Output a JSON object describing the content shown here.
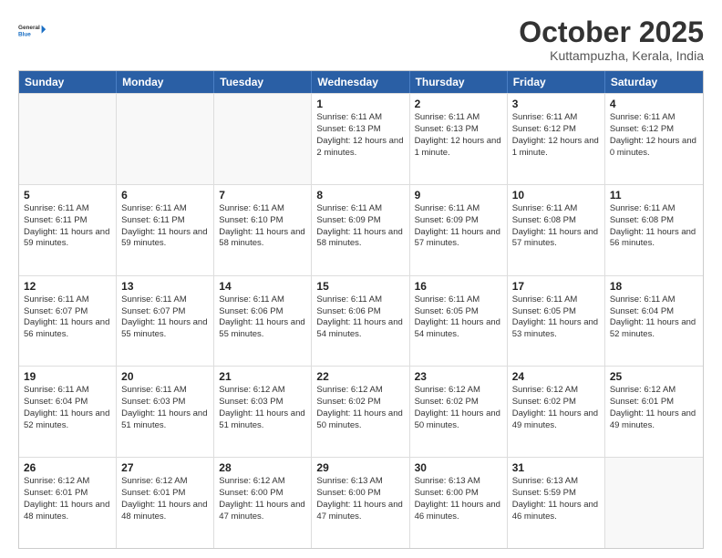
{
  "header": {
    "logo_general": "General",
    "logo_blue": "Blue",
    "month_title": "October 2025",
    "subtitle": "Kuttampuzha, Kerala, India"
  },
  "calendar": {
    "days_of_week": [
      "Sunday",
      "Monday",
      "Tuesday",
      "Wednesday",
      "Thursday",
      "Friday",
      "Saturday"
    ],
    "rows": [
      [
        {
          "day": "",
          "info": "",
          "empty": true
        },
        {
          "day": "",
          "info": "",
          "empty": true
        },
        {
          "day": "",
          "info": "",
          "empty": true
        },
        {
          "day": "1",
          "info": "Sunrise: 6:11 AM\nSunset: 6:13 PM\nDaylight: 12 hours\nand 2 minutes.",
          "empty": false
        },
        {
          "day": "2",
          "info": "Sunrise: 6:11 AM\nSunset: 6:13 PM\nDaylight: 12 hours\nand 1 minute.",
          "empty": false
        },
        {
          "day": "3",
          "info": "Sunrise: 6:11 AM\nSunset: 6:12 PM\nDaylight: 12 hours\nand 1 minute.",
          "empty": false
        },
        {
          "day": "4",
          "info": "Sunrise: 6:11 AM\nSunset: 6:12 PM\nDaylight: 12 hours\nand 0 minutes.",
          "empty": false
        }
      ],
      [
        {
          "day": "5",
          "info": "Sunrise: 6:11 AM\nSunset: 6:11 PM\nDaylight: 11 hours\nand 59 minutes.",
          "empty": false
        },
        {
          "day": "6",
          "info": "Sunrise: 6:11 AM\nSunset: 6:11 PM\nDaylight: 11 hours\nand 59 minutes.",
          "empty": false
        },
        {
          "day": "7",
          "info": "Sunrise: 6:11 AM\nSunset: 6:10 PM\nDaylight: 11 hours\nand 58 minutes.",
          "empty": false
        },
        {
          "day": "8",
          "info": "Sunrise: 6:11 AM\nSunset: 6:09 PM\nDaylight: 11 hours\nand 58 minutes.",
          "empty": false
        },
        {
          "day": "9",
          "info": "Sunrise: 6:11 AM\nSunset: 6:09 PM\nDaylight: 11 hours\nand 57 minutes.",
          "empty": false
        },
        {
          "day": "10",
          "info": "Sunrise: 6:11 AM\nSunset: 6:08 PM\nDaylight: 11 hours\nand 57 minutes.",
          "empty": false
        },
        {
          "day": "11",
          "info": "Sunrise: 6:11 AM\nSunset: 6:08 PM\nDaylight: 11 hours\nand 56 minutes.",
          "empty": false
        }
      ],
      [
        {
          "day": "12",
          "info": "Sunrise: 6:11 AM\nSunset: 6:07 PM\nDaylight: 11 hours\nand 56 minutes.",
          "empty": false
        },
        {
          "day": "13",
          "info": "Sunrise: 6:11 AM\nSunset: 6:07 PM\nDaylight: 11 hours\nand 55 minutes.",
          "empty": false
        },
        {
          "day": "14",
          "info": "Sunrise: 6:11 AM\nSunset: 6:06 PM\nDaylight: 11 hours\nand 55 minutes.",
          "empty": false
        },
        {
          "day": "15",
          "info": "Sunrise: 6:11 AM\nSunset: 6:06 PM\nDaylight: 11 hours\nand 54 minutes.",
          "empty": false
        },
        {
          "day": "16",
          "info": "Sunrise: 6:11 AM\nSunset: 6:05 PM\nDaylight: 11 hours\nand 54 minutes.",
          "empty": false
        },
        {
          "day": "17",
          "info": "Sunrise: 6:11 AM\nSunset: 6:05 PM\nDaylight: 11 hours\nand 53 minutes.",
          "empty": false
        },
        {
          "day": "18",
          "info": "Sunrise: 6:11 AM\nSunset: 6:04 PM\nDaylight: 11 hours\nand 52 minutes.",
          "empty": false
        }
      ],
      [
        {
          "day": "19",
          "info": "Sunrise: 6:11 AM\nSunset: 6:04 PM\nDaylight: 11 hours\nand 52 minutes.",
          "empty": false
        },
        {
          "day": "20",
          "info": "Sunrise: 6:11 AM\nSunset: 6:03 PM\nDaylight: 11 hours\nand 51 minutes.",
          "empty": false
        },
        {
          "day": "21",
          "info": "Sunrise: 6:12 AM\nSunset: 6:03 PM\nDaylight: 11 hours\nand 51 minutes.",
          "empty": false
        },
        {
          "day": "22",
          "info": "Sunrise: 6:12 AM\nSunset: 6:02 PM\nDaylight: 11 hours\nand 50 minutes.",
          "empty": false
        },
        {
          "day": "23",
          "info": "Sunrise: 6:12 AM\nSunset: 6:02 PM\nDaylight: 11 hours\nand 50 minutes.",
          "empty": false
        },
        {
          "day": "24",
          "info": "Sunrise: 6:12 AM\nSunset: 6:02 PM\nDaylight: 11 hours\nand 49 minutes.",
          "empty": false
        },
        {
          "day": "25",
          "info": "Sunrise: 6:12 AM\nSunset: 6:01 PM\nDaylight: 11 hours\nand 49 minutes.",
          "empty": false
        }
      ],
      [
        {
          "day": "26",
          "info": "Sunrise: 6:12 AM\nSunset: 6:01 PM\nDaylight: 11 hours\nand 48 minutes.",
          "empty": false
        },
        {
          "day": "27",
          "info": "Sunrise: 6:12 AM\nSunset: 6:01 PM\nDaylight: 11 hours\nand 48 minutes.",
          "empty": false
        },
        {
          "day": "28",
          "info": "Sunrise: 6:12 AM\nSunset: 6:00 PM\nDaylight: 11 hours\nand 47 minutes.",
          "empty": false
        },
        {
          "day": "29",
          "info": "Sunrise: 6:13 AM\nSunset: 6:00 PM\nDaylight: 11 hours\nand 47 minutes.",
          "empty": false
        },
        {
          "day": "30",
          "info": "Sunrise: 6:13 AM\nSunset: 6:00 PM\nDaylight: 11 hours\nand 46 minutes.",
          "empty": false
        },
        {
          "day": "31",
          "info": "Sunrise: 6:13 AM\nSunset: 5:59 PM\nDaylight: 11 hours\nand 46 minutes.",
          "empty": false
        },
        {
          "day": "",
          "info": "",
          "empty": true
        }
      ]
    ]
  }
}
